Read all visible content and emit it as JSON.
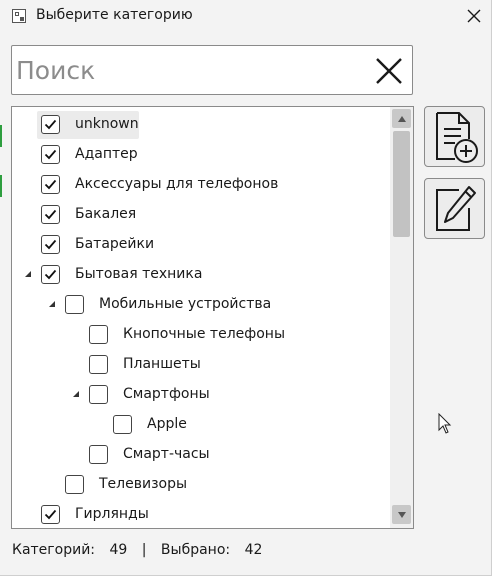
{
  "window": {
    "title": "Выберите категорию"
  },
  "search": {
    "placeholder": "Поиск",
    "value": ""
  },
  "tree": {
    "items": [
      {
        "label": "unknown",
        "level": 0,
        "checked": true,
        "expanded": null,
        "highlighted": true
      },
      {
        "label": "Адаптер",
        "level": 0,
        "checked": true,
        "expanded": null
      },
      {
        "label": "Аксессуары для телефонов",
        "level": 0,
        "checked": true,
        "expanded": null
      },
      {
        "label": "Бакалея",
        "level": 0,
        "checked": true,
        "expanded": null
      },
      {
        "label": "Батарейки",
        "level": 0,
        "checked": true,
        "expanded": null
      },
      {
        "label": "Бытовая техника",
        "level": 0,
        "checked": true,
        "expanded": true
      },
      {
        "label": "Мобильные устройства",
        "level": 1,
        "checked": false,
        "expanded": true
      },
      {
        "label": "Кнопочные телефоны",
        "level": 2,
        "checked": false,
        "expanded": null
      },
      {
        "label": "Планшеты",
        "level": 2,
        "checked": false,
        "expanded": null
      },
      {
        "label": "Смартфоны",
        "level": 2,
        "checked": false,
        "expanded": true
      },
      {
        "label": "Apple",
        "level": 3,
        "checked": false,
        "expanded": null
      },
      {
        "label": "Смарт-часы",
        "level": 2,
        "checked": false,
        "expanded": null
      },
      {
        "label": "Телевизоры",
        "level": 1,
        "checked": false,
        "expanded": null
      },
      {
        "label": "Гирлянды",
        "level": 0,
        "checked": true,
        "expanded": null
      }
    ]
  },
  "actions": {
    "add_icon": "add-document-icon",
    "edit_icon": "edit-document-icon"
  },
  "status": {
    "categories_label": "Категорий:",
    "categories_count": "49",
    "separator": "|",
    "selected_label": "Выбрано:",
    "selected_count": "42"
  },
  "colors": {
    "background": "#f3f3f3",
    "field_border": "#8a8a8a",
    "highlight": "#ebebeb",
    "scroll_thumb": "#c2c2c2"
  }
}
